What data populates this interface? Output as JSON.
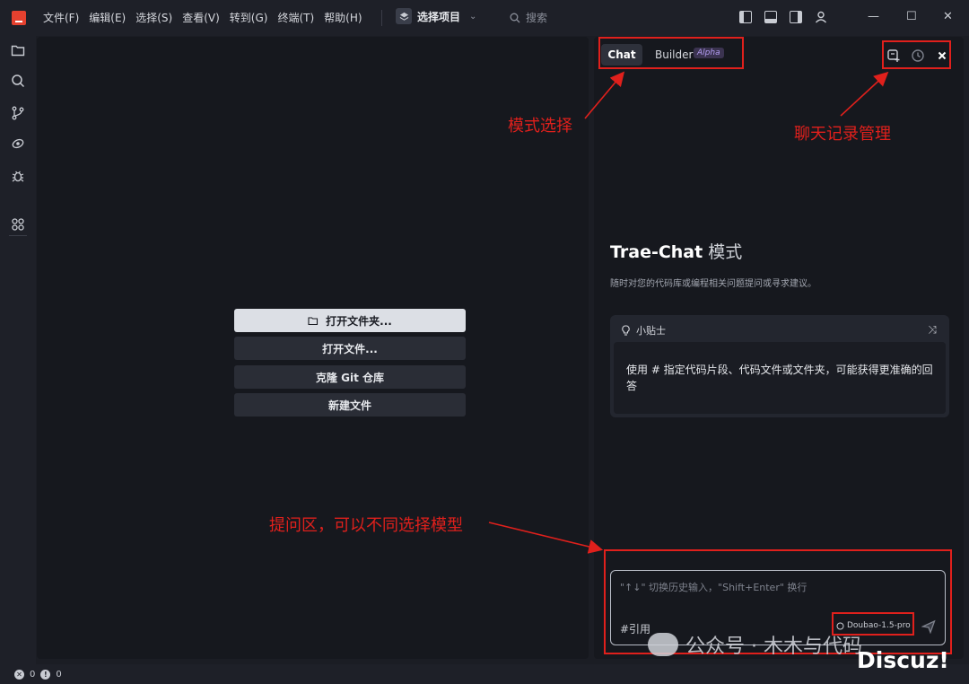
{
  "titlebar": {
    "menu": [
      "文件(F)",
      "编辑(E)",
      "选择(S)",
      "查看(V)",
      "转到(G)",
      "终端(T)",
      "帮助(H)"
    ],
    "project_label": "选择项目",
    "search_placeholder": "搜索"
  },
  "editor": {
    "buttons": {
      "open_folder": "打开文件夹...",
      "open_file": "打开文件...",
      "clone_git": "克隆 Git 仓库",
      "new_file": "新建文件"
    }
  },
  "chat": {
    "tabs": {
      "chat": "Chat",
      "builder": "Builder",
      "builder_badge": "Alpha"
    },
    "title": "Trae-Chat",
    "title_suffix": "模式",
    "description": "随时对您的代码库或编程相关问题提问或寻求建议。",
    "tips": {
      "header": "小贴士",
      "body": "使用 # 指定代码片段、代码文件或文件夹，可能获得更准确的回答"
    },
    "input": {
      "placeholder": "\"↑↓\" 切换历史输入，\"Shift+Enter\" 换行",
      "reference_label": "#引用",
      "model": "Doubao-1.5-pro"
    }
  },
  "annotations": {
    "mode_select": "模式选择",
    "history_manage": "聊天记录管理",
    "input_area": "提问区，可以不同选择模型",
    "color": "#e0201c"
  },
  "status": {
    "errors": "0",
    "warnings": "0"
  },
  "watermarks": {
    "wechat": "公众号 · 木木与代码",
    "discuz": "Discuz!"
  },
  "colors": {
    "logo": "#e5412f",
    "accent_badge": "#b29cf0"
  }
}
